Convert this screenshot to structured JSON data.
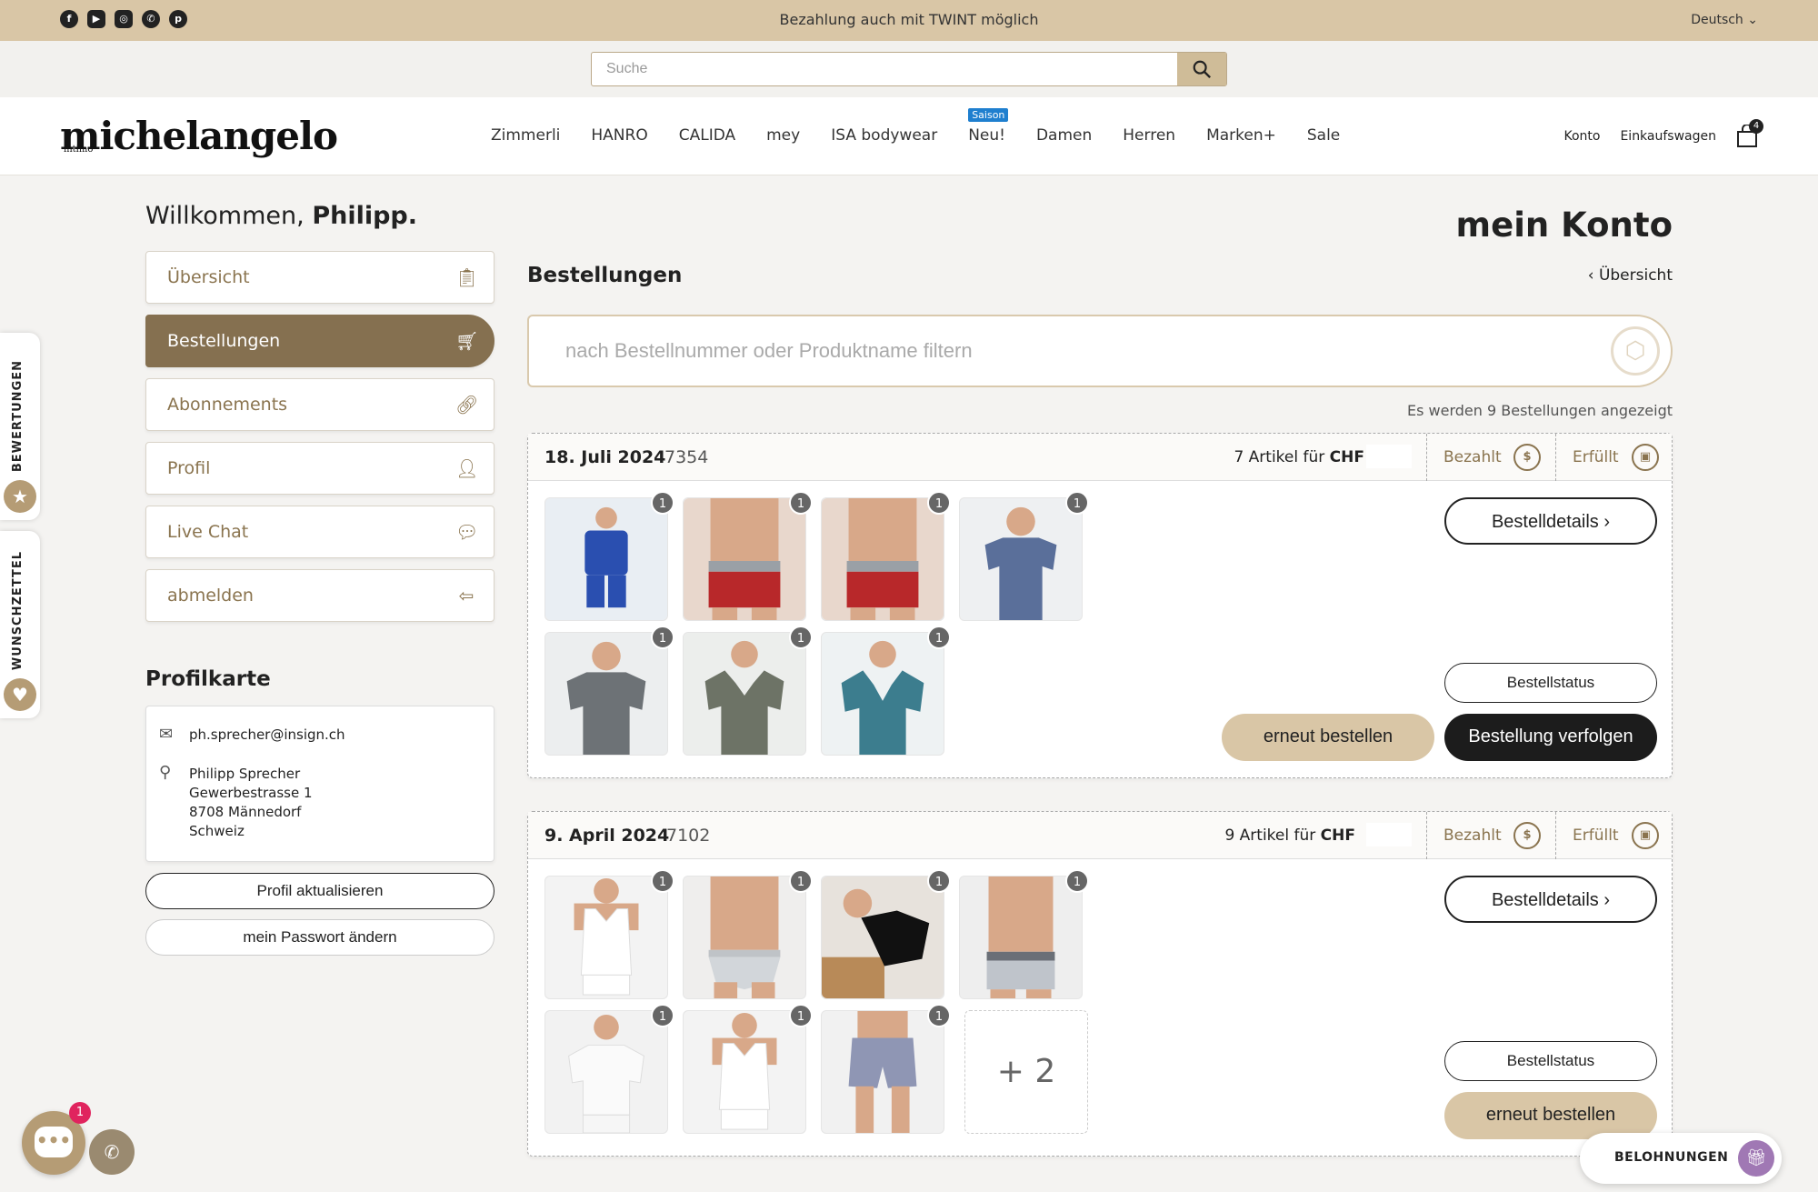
{
  "topbar": {
    "social_icons": [
      "facebook-icon",
      "youtube-icon",
      "instagram-icon",
      "whatsapp-icon",
      "pinterest-icon"
    ],
    "announcement": "Bezahlung auch mit TWINT möglich",
    "language": "Deutsch"
  },
  "search": {
    "placeholder": "Suche"
  },
  "header": {
    "logo": "michelangelo",
    "logo_sub": "intimo",
    "nav": [
      "Zimmerli",
      "HANRO",
      "CALIDA",
      "mey",
      "ISA bodywear",
      "Neu!",
      "Damen",
      "Herren",
      "Marken+",
      "Sale"
    ],
    "nav_badge": "Saison",
    "account": "Konto",
    "cart": "Einkaufswagen",
    "cart_count": "4"
  },
  "side_tabs": {
    "reviews": "BEWERTUNGEN",
    "wishlist": "WUNSCHZETTEL"
  },
  "welcome": {
    "greeting": "Willkommen,",
    "name": "Philipp."
  },
  "menu": [
    {
      "label": "Übersicht",
      "icon": "clipboard-icon"
    },
    {
      "label": "Bestellungen",
      "icon": "cart-icon"
    },
    {
      "label": "Abonnements",
      "icon": "link-icon"
    },
    {
      "label": "Profil",
      "icon": "user-icon"
    },
    {
      "label": "Live Chat",
      "icon": "chat-icon"
    },
    {
      "label": "abmelden",
      "icon": "logout-icon"
    }
  ],
  "profile": {
    "title": "Profilkarte",
    "email": "ph.sprecher@insign.ch",
    "address": [
      "Philipp Sprecher",
      "Gewerbestrasse 1",
      "8708 Männedorf",
      "Schweiz"
    ],
    "update_btn": "Profil aktualisieren",
    "password_btn": "mein Passwort ändern"
  },
  "main": {
    "page_title": "mein Konto",
    "section_title": "Bestellungen",
    "back_link": "Übersicht",
    "filter_placeholder": "nach Bestellnummer oder Produktname filtern",
    "count_info": "Es werden 9 Bestellungen angezeigt",
    "orders": [
      {
        "date": "18. Juli 2024",
        "number": "7354",
        "articles": "7 Artikel für",
        "currency": "CHF",
        "paid": "Bezahlt",
        "fulfilled": "Erfüllt",
        "details_btn": "Bestelldetails",
        "status_btn": "Bestellstatus",
        "reorder_btn": "erneut bestellen",
        "track_btn": "Bestellung verfolgen",
        "items": [
          {
            "qty": "1",
            "kind": "pajama"
          },
          {
            "qty": "1",
            "kind": "red-trunks"
          },
          {
            "qty": "1",
            "kind": "red-trunks"
          },
          {
            "qty": "1",
            "kind": "blue-tee"
          },
          {
            "qty": "1",
            "kind": "grey-tee"
          },
          {
            "qty": "1",
            "kind": "olive-tee"
          },
          {
            "qty": "1",
            "kind": "petrol-tee"
          }
        ]
      },
      {
        "date": "9. April 2024",
        "number": "7102",
        "articles": "9 Artikel für",
        "currency": "CHF",
        "paid": "Bezahlt",
        "fulfilled": "Erfüllt",
        "details_btn": "Bestelldetails",
        "status_btn": "Bestellstatus",
        "reorder_btn": "erneut bestellen",
        "more": "+ 2",
        "items": [
          {
            "qty": "1",
            "kind": "white-tank"
          },
          {
            "qty": "1",
            "kind": "grey-briefs"
          },
          {
            "qty": "1",
            "kind": "black-tee"
          },
          {
            "qty": "1",
            "kind": "grey-trunks"
          },
          {
            "qty": "1",
            "kind": "white-tee"
          },
          {
            "qty": "1",
            "kind": "white-tank"
          },
          {
            "qty": "1",
            "kind": "shorts"
          }
        ]
      }
    ]
  },
  "floating": {
    "chat_badge": "1",
    "rewards": "BELOHNUNGEN"
  },
  "colors": {
    "brand": "#857050",
    "tan": "#d9c6a6",
    "dark": "#1c1c1c"
  }
}
